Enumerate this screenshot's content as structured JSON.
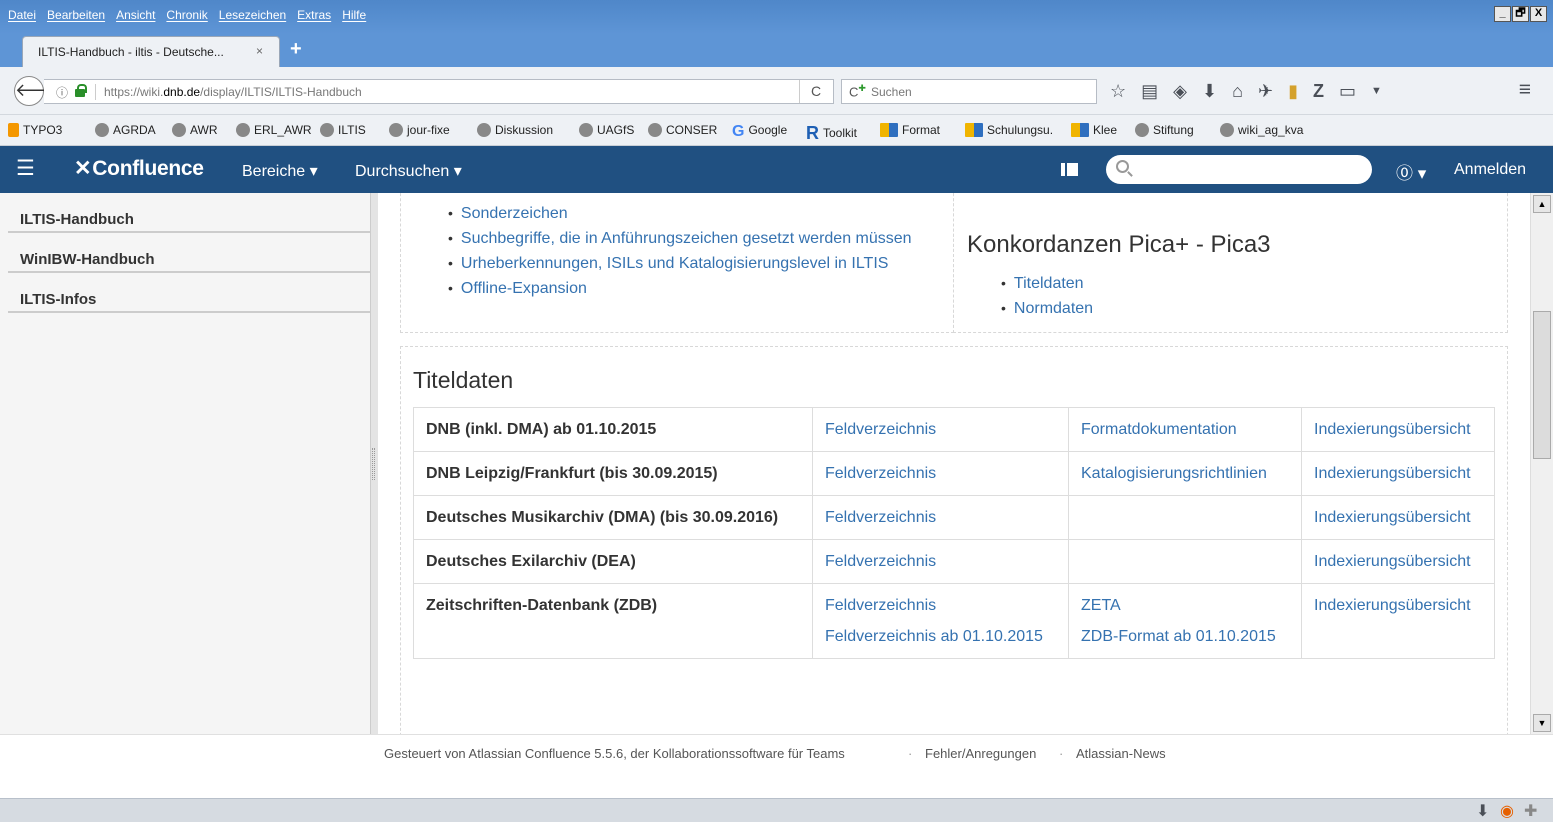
{
  "browser": {
    "menu": [
      "Datei",
      "Bearbeiten",
      "Ansicht",
      "Chronik",
      "Lesezeichen",
      "Extras",
      "Hilfe"
    ],
    "window_controls": [
      "_",
      "🗗",
      "X"
    ],
    "tab_title": "ILTIS-Handbuch - iltis - Deutsche...",
    "tab_close": "×",
    "new_tab": "+",
    "url_prefix": "https://wiki.",
    "url_domain": "dnb.de",
    "url_path": "/display/ILTIS/ILTIS-Handbuch",
    "reload": "C",
    "search_placeholder": "Suchen",
    "bookmarks": [
      {
        "label": "TYPO3",
        "icon": "typo3-icon"
      },
      {
        "label": "AGRDA",
        "icon": "globe-icon"
      },
      {
        "label": "AWR",
        "icon": "globe-icon"
      },
      {
        "label": "ERL_AWR",
        "icon": "globe-icon"
      },
      {
        "label": "ILTIS",
        "icon": "globe-icon"
      },
      {
        "label": "jour-fixe",
        "icon": "globe-icon"
      },
      {
        "label": "Diskussion",
        "icon": "globe-icon"
      },
      {
        "label": "UAGfS",
        "icon": "globe-icon"
      },
      {
        "label": "CONSER",
        "icon": "globe-icon"
      },
      {
        "label": "Google",
        "icon": "google-icon"
      },
      {
        "label": "Toolkit",
        "icon": "r-icon"
      },
      {
        "label": "Format",
        "icon": "zdb-icon"
      },
      {
        "label": "Schulungsu.",
        "icon": "zdb-icon"
      },
      {
        "label": "Klee",
        "icon": "zdb-icon"
      },
      {
        "label": "Stiftung",
        "icon": "globe-icon"
      },
      {
        "label": "wiki_ag_kva",
        "icon": "globe-icon"
      }
    ]
  },
  "confluence": {
    "logo": "Confluence",
    "nav_spaces": "Bereiche ▾",
    "nav_browse": "Durchsuchen ▾",
    "help": "⓪ ▾",
    "login": "Anmelden"
  },
  "sidebar": {
    "items": [
      "ILTIS-Handbuch",
      "WinIBW-Handbuch",
      "ILTIS-Infos"
    ]
  },
  "content": {
    "top_list": [
      "Sonderzeichen",
      "Suchbegriffe, die in Anführungszeichen gesetzt werden müssen",
      "Urheberkennungen, ISILs und Katalogisierungslevel in ILTIS",
      "Offline-Expansion"
    ],
    "konkordanzen_title": "Konkordanzen Pica+ - Pica3",
    "konkordanzen_list": [
      "Titeldaten",
      "Normdaten"
    ],
    "titeldaten_title": "Titeldaten",
    "table": [
      {
        "name": "DNB (inkl. DMA) ab 01.10.2015",
        "col2": [
          "Feldverzeichnis"
        ],
        "col3": [
          "Formatdokumentation"
        ],
        "col4": "Indexierungsübersicht"
      },
      {
        "name": "DNB Leipzig/Frankfurt (bis 30.09.2015)",
        "col2": [
          "Feldverzeichnis"
        ],
        "col3": [
          "Katalogisierungsrichtlinien"
        ],
        "col4": "Indexierungsübersicht"
      },
      {
        "name": "Deutsches Musikarchiv (DMA) (bis 30.09.2016)",
        "col2": [
          "Feldverzeichnis"
        ],
        "col3": [],
        "col4": "Indexierungsübersicht"
      },
      {
        "name": "Deutsches Exilarchiv (DEA)",
        "col2": [
          "Feldverzeichnis"
        ],
        "col3": [],
        "col4": "Indexierungsübersicht"
      },
      {
        "name": "Zeitschriften-Datenbank (ZDB)",
        "col2": [
          "Feldverzeichnis",
          "Feldverzeichnis ab 01.10.2015"
        ],
        "col3": [
          "ZETA",
          "ZDB-Format ab 01.10.2015"
        ],
        "col4": "Indexierungsübersicht"
      }
    ]
  },
  "footer": {
    "powered": "Gesteuert von Atlassian Confluence 5.5.6, der Kollaborationssoftware für Teams",
    "sep": "·",
    "feedback": "Fehler/Anregungen",
    "news": "Atlassian-News"
  }
}
